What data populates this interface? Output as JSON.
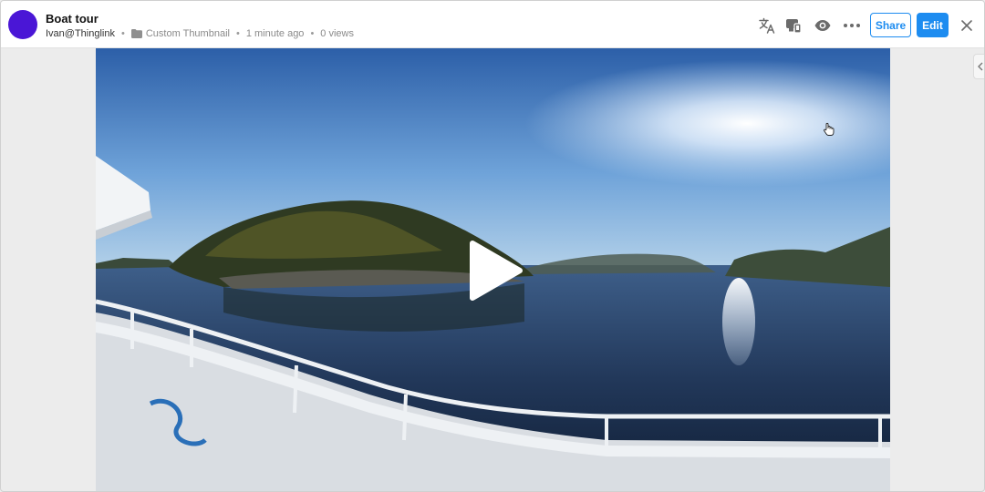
{
  "header": {
    "title": "Boat tour",
    "author": "Ivan@Thinglink",
    "folder": "Custom Thumbnail",
    "time": "1 minute ago",
    "views": "0 views",
    "separator": "•"
  },
  "toolbar": {
    "share_label": "Share",
    "edit_label": "Edit",
    "icons": [
      "translate-icon",
      "devices-icon",
      "eye-icon",
      "more-icon",
      "close-icon"
    ]
  },
  "media": {
    "description_icons": [
      "play-icon"
    ],
    "side_panel_icon": "chevron-left-icon"
  },
  "colors": {
    "accent": "#1d8cf0",
    "avatar": "#4a16d6"
  }
}
